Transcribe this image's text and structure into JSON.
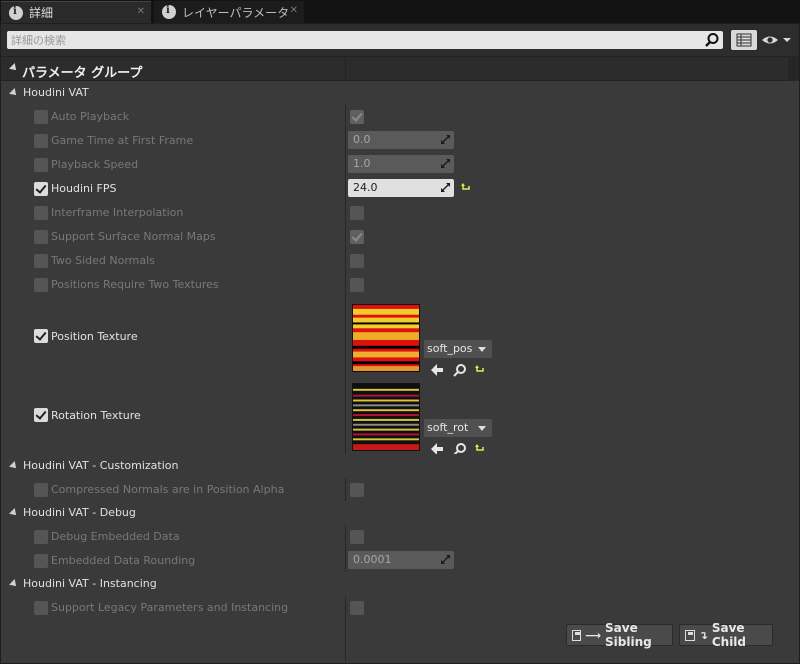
{
  "tabs": [
    {
      "label": "詳細",
      "icon": "info-icon"
    },
    {
      "label": "レイヤーパラメータ",
      "icon": "info-icon"
    }
  ],
  "search": {
    "placeholder": "詳細の検索"
  },
  "group": {
    "title": "パラメータ グループ"
  },
  "categories": {
    "vat": "Houdini VAT",
    "customization": "Houdini VAT - Customization",
    "debug": "Houdini VAT - Debug",
    "instancing": "Houdini VAT - Instancing"
  },
  "params": {
    "auto_playback": {
      "label": "Auto Playback",
      "override": false,
      "value_checked": true
    },
    "game_time": {
      "label": "Game Time at First Frame",
      "override": false,
      "value": "0.0"
    },
    "playback_speed": {
      "label": "Playback Speed",
      "override": false,
      "value": "1.0"
    },
    "houdini_fps": {
      "label": "Houdini FPS",
      "override": true,
      "value": "24.0"
    },
    "interframe": {
      "label": "Interframe Interpolation",
      "override": false,
      "value_checked": false
    },
    "surface_normals": {
      "label": "Support Surface Normal Maps",
      "override": false,
      "value_checked": true
    },
    "two_sided": {
      "label": "Two Sided Normals",
      "override": false,
      "value_checked": false
    },
    "two_textures": {
      "label": "Positions Require Two Textures",
      "override": false,
      "value_checked": false
    },
    "position_texture": {
      "label": "Position Texture",
      "override": true,
      "asset": "soft_pos"
    },
    "rotation_texture": {
      "label": "Rotation Texture",
      "override": true,
      "asset": "soft_rot"
    },
    "compressed_normals": {
      "label": "Compressed Normals are in Position Alpha",
      "override": false,
      "value_checked": false
    },
    "debug_embedded": {
      "label": "Debug Embedded Data",
      "override": false,
      "value_checked": false
    },
    "embedded_rounding": {
      "label": "Embedded Data Rounding",
      "override": false,
      "value": "0.0001"
    },
    "legacy": {
      "label": "Support Legacy Parameters and Instancing",
      "override": false,
      "value_checked": false
    }
  },
  "buttons": {
    "save_sibling": "Save Sibling",
    "save_child": "Save Child"
  },
  "colors": {
    "panel_bg": "#3a3a3a",
    "reset_arrow": "#e8e84a",
    "texture_red": "#e01010",
    "texture_yellow": "#f2e22c"
  }
}
